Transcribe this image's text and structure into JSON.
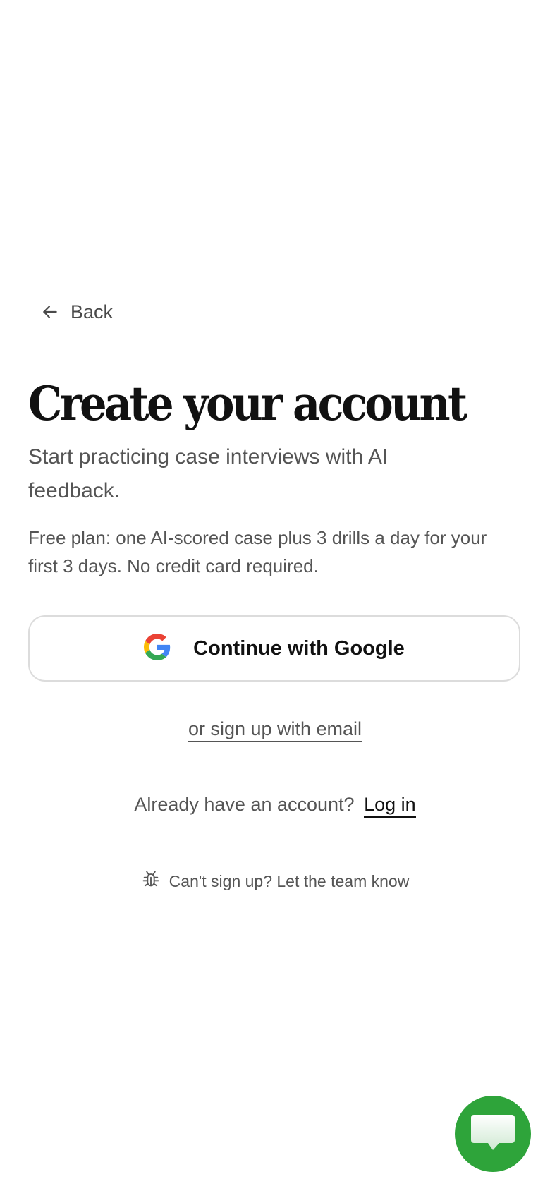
{
  "nav": {
    "back_label": "Back"
  },
  "header": {
    "title": "Create your account",
    "subtitle": "Start practicing case interviews with AI feedback.",
    "plan_note": "Free plan: one AI-scored case plus 3 drills a day for your first 3 days. No credit card required."
  },
  "auth": {
    "google_label": "Continue with Google",
    "email_label": "or sign up with email",
    "login_prompt": "Already have an account?",
    "login_label": "Log in"
  },
  "support": {
    "report_label": "Can't sign up? Let the team know"
  },
  "icons": {
    "back": "arrow-left-icon",
    "google": "google-logo-icon",
    "report": "bug-icon",
    "chat": "chat-bubble-icon"
  },
  "colors": {
    "chat_fab": "#2ea43a",
    "title": "#111111",
    "muted_text": "#555555",
    "button_border": "#dcdcdc"
  }
}
